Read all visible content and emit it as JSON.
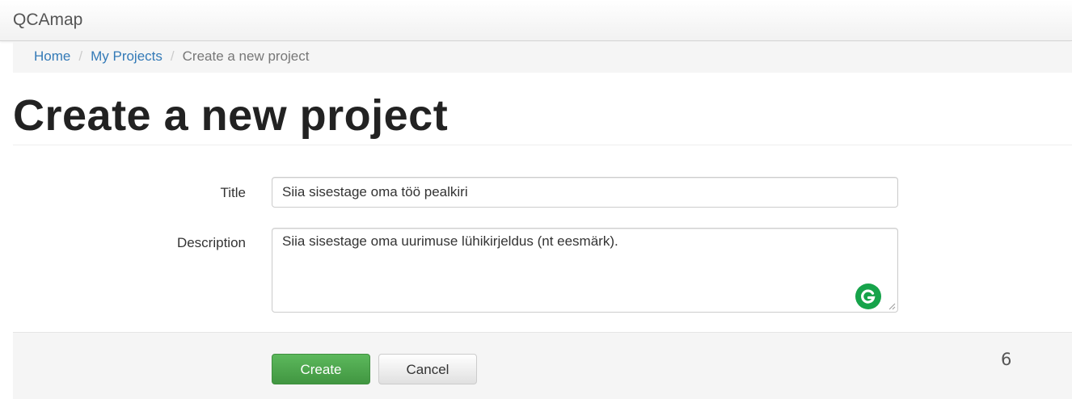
{
  "navbar": {
    "brand": "QCAmap"
  },
  "breadcrumb": {
    "items": [
      {
        "label": "Home",
        "link": true
      },
      {
        "label": "My Projects",
        "link": true
      },
      {
        "label": "Create a new project",
        "link": false
      }
    ],
    "separator": "/"
  },
  "page": {
    "title": "Create a new project"
  },
  "form": {
    "title_label": "Title",
    "title_value": "Siia sisestage oma töö pealkiri",
    "description_label": "Description",
    "description_value": "Siia sisestage oma uurimuse lühikirjeldus (nt eesmärk).",
    "create_label": "Create",
    "cancel_label": "Cancel"
  },
  "slide": {
    "number": "6"
  },
  "colors": {
    "link": "#337ab7",
    "create_button": "#5cb85c",
    "grammarly": "#16a34a"
  }
}
